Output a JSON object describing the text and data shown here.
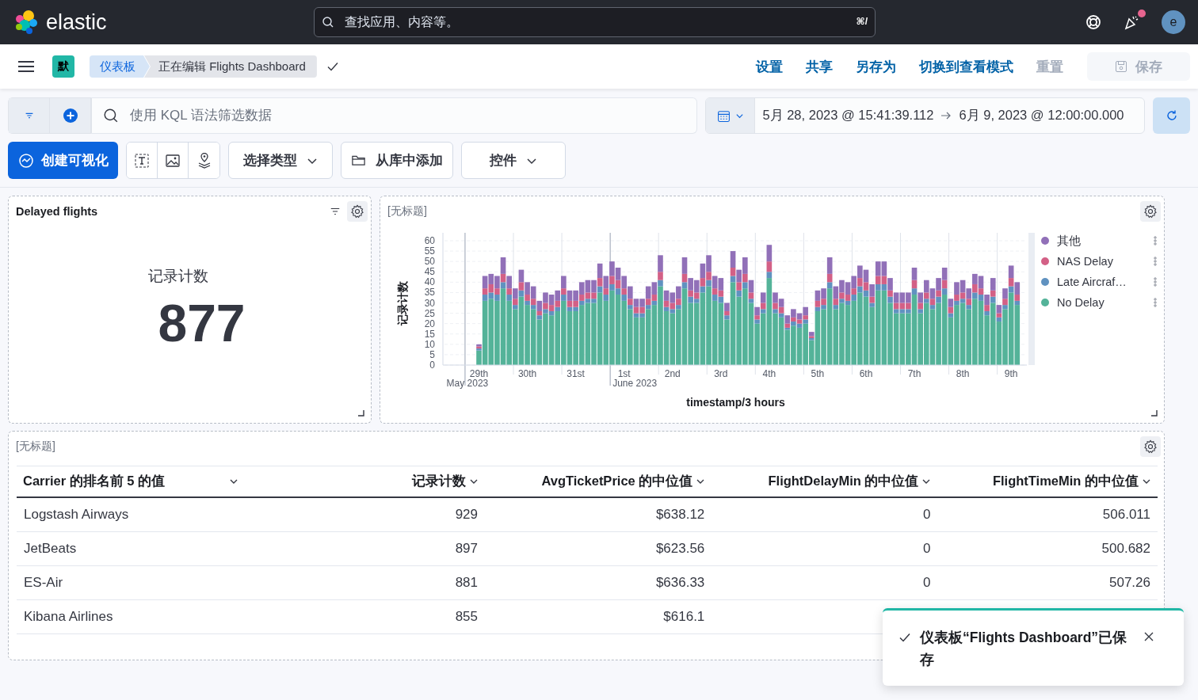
{
  "header": {
    "logo_text": "elastic",
    "search": {
      "placeholder": "查找应用、内容等。",
      "shortcut": "⌘/"
    },
    "news_unread": true,
    "avatar": "e"
  },
  "nav": {
    "space_badge": "默",
    "breadcrumbs": [
      {
        "label": "仪表板",
        "selected": false
      },
      {
        "label": "正在编辑 Flights Dashboard",
        "selected": true
      }
    ],
    "menu": [
      {
        "label": "设置",
        "disabled": false
      },
      {
        "label": "共享",
        "disabled": false
      },
      {
        "label": "另存为",
        "disabled": false
      },
      {
        "label": "切换到查看模式",
        "disabled": false
      },
      {
        "label": "重置",
        "disabled": true
      }
    ],
    "save_button": {
      "label": "保存",
      "disabled": true
    }
  },
  "query": {
    "placeholder": "使用 KQL 语法筛选数据",
    "start": "5月 28, 2023 @ 15:41:39.112",
    "end": "6月 9, 2023 @ 12:00:00.000"
  },
  "toolbar": {
    "create": "创建可视化",
    "type_select": "选择类型",
    "library": "从库中添加",
    "controls": "控件"
  },
  "metric_panel": {
    "title": "Delayed flights",
    "label": "记录计数",
    "value": "877"
  },
  "chart_panel": {
    "title": "[无标题]",
    "chart_data": {
      "type": "bar",
      "stacked": true,
      "grid": true,
      "annotations": [
        "May 2023",
        "June 2023"
      ],
      "xlabel": "timestamp/3 hours",
      "ylabel": "记录计数",
      "ylim": [
        0,
        60
      ],
      "yticks": [
        0,
        5,
        10,
        15,
        20,
        25,
        30,
        35,
        40,
        45,
        50,
        55,
        60
      ],
      "categories": [
        "29th",
        null,
        null,
        null,
        null,
        null,
        null,
        null,
        "30th",
        null,
        null,
        null,
        null,
        null,
        null,
        null,
        "31st",
        null,
        null,
        null,
        null,
        null,
        null,
        null,
        "1st",
        null,
        null,
        null,
        null,
        null,
        null,
        null,
        "2nd",
        null,
        null,
        null,
        null,
        null,
        null,
        null,
        "3rd",
        null,
        null,
        null,
        null,
        null,
        null,
        null,
        "4th",
        null,
        null,
        null,
        null,
        null,
        null,
        null,
        "5th",
        null,
        null,
        null,
        null,
        null,
        null,
        null,
        "6th",
        null,
        null,
        null,
        null,
        null,
        null,
        null,
        "7th",
        null,
        null,
        null,
        null,
        null,
        null,
        null,
        "8th",
        null,
        null,
        null,
        null,
        null,
        null,
        null,
        "9th",
        null
      ],
      "series": [
        {
          "name": "其他",
          "color": "#9170b8",
          "values": [
            1,
            6,
            5,
            6,
            8,
            6,
            5,
            6,
            6,
            6,
            5,
            5,
            5,
            5,
            6,
            5,
            5,
            6,
            6,
            6,
            7,
            6,
            7,
            6,
            6,
            6,
            4,
            4,
            6,
            6,
            8,
            5,
            5,
            6,
            8,
            6,
            6,
            7,
            8,
            6,
            6,
            4,
            8,
            6,
            8,
            6,
            4,
            5,
            8,
            5,
            4,
            4,
            4,
            3,
            4,
            2,
            5,
            5,
            8,
            6,
            6,
            6,
            6,
            6,
            6,
            6,
            7,
            7,
            6,
            5,
            5,
            5,
            6,
            5,
            6,
            5,
            6,
            6,
            4,
            6,
            6,
            5,
            5,
            6,
            5,
            6,
            4,
            5,
            6,
            6
          ]
        },
        {
          "name": "NAS Delay",
          "color": "#d36086",
          "values": [
            1,
            3,
            4,
            3,
            4,
            3,
            3,
            4,
            3,
            3,
            2,
            3,
            3,
            3,
            3,
            3,
            3,
            3,
            3,
            3,
            4,
            3,
            4,
            4,
            3,
            3,
            3,
            3,
            3,
            3,
            4,
            3,
            3,
            3,
            4,
            3,
            3,
            4,
            4,
            3,
            3,
            2,
            4,
            4,
            4,
            3,
            2,
            3,
            5,
            3,
            3,
            2,
            2,
            2,
            2,
            1,
            3,
            3,
            4,
            3,
            3,
            3,
            3,
            4,
            4,
            3,
            4,
            4,
            3,
            3,
            3,
            3,
            4,
            3,
            3,
            3,
            3,
            4,
            3,
            3,
            3,
            3,
            4,
            3,
            3,
            3,
            2,
            3,
            4,
            3
          ]
        },
        {
          "name": "Late Aircraf…",
          "color": "#6092c0",
          "values": [
            1,
            3,
            3,
            3,
            3,
            3,
            2,
            3,
            2,
            2,
            2,
            2,
            2,
            2,
            3,
            2,
            2,
            2,
            2,
            2,
            3,
            3,
            3,
            3,
            3,
            2,
            2,
            2,
            2,
            2,
            3,
            2,
            2,
            2,
            3,
            3,
            2,
            3,
            3,
            3,
            3,
            2,
            3,
            3,
            3,
            2,
            2,
            2,
            3,
            2,
            2,
            1,
            2,
            2,
            2,
            1,
            2,
            2,
            3,
            2,
            2,
            2,
            3,
            3,
            3,
            2,
            3,
            3,
            3,
            2,
            2,
            2,
            3,
            2,
            2,
            2,
            3,
            3,
            2,
            2,
            2,
            2,
            3,
            3,
            2,
            3,
            2,
            2,
            3,
            2
          ]
        },
        {
          "name": "No Delay",
          "color": "#54b399",
          "values": [
            7,
            31,
            32,
            31,
            37,
            31,
            27,
            33,
            29,
            27,
            22,
            25,
            24,
            26,
            31,
            26,
            26,
            29,
            30,
            30,
            35,
            31,
            36,
            34,
            31,
            27,
            23,
            23,
            27,
            29,
            38,
            26,
            25,
            27,
            37,
            30,
            30,
            35,
            38,
            31,
            30,
            22,
            40,
            33,
            37,
            30,
            20,
            25,
            42,
            25,
            23,
            17,
            19,
            18,
            20,
            12,
            26,
            27,
            37,
            27,
            30,
            29,
            31,
            35,
            33,
            28,
            36,
            36,
            30,
            25,
            25,
            25,
            34,
            25,
            30,
            27,
            30,
            34,
            23,
            29,
            30,
            27,
            32,
            31,
            24,
            30,
            21,
            27,
            35,
            29
          ]
        }
      ]
    }
  },
  "table_panel": {
    "title": "[无标题]",
    "columns": [
      "Carrier 的排名前 5 的值",
      "记录计数",
      "AvgTicketPrice 的中位值",
      "FlightDelayMin 的中位值",
      "FlightTimeMin 的中位值"
    ],
    "rows": [
      [
        "Logstash Airways",
        "929",
        "$638.12",
        "0",
        "506.011"
      ],
      [
        "JetBeats",
        "897",
        "$623.56",
        "0",
        "500.682"
      ],
      [
        "ES-Air",
        "881",
        "$636.33",
        "0",
        "507.26"
      ],
      [
        "Kibana Airlines",
        "855",
        "$616.1"
      ]
    ]
  },
  "toast": {
    "title": "仪表板“Flights Dashboard”已保存"
  }
}
